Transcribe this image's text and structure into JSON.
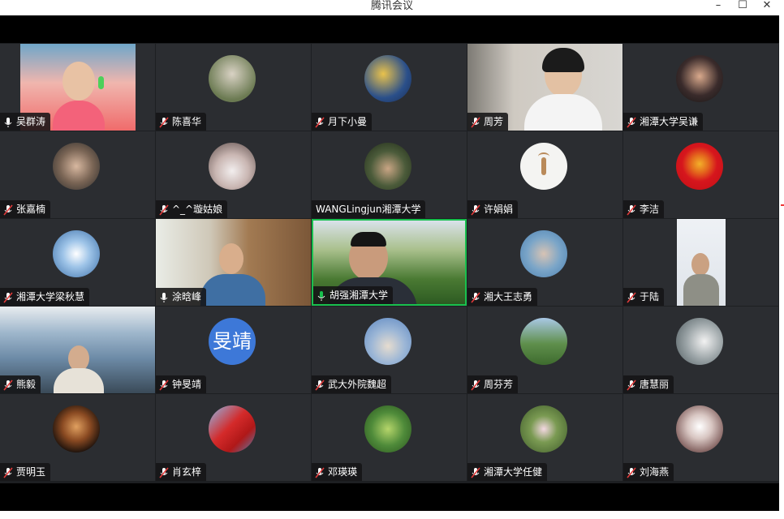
{
  "window": {
    "title": "腾讯会议",
    "minimize": "–",
    "maximize": "☐",
    "close": "✕"
  },
  "participants": [
    {
      "name": "吴群涛",
      "mic": "on"
    },
    {
      "name": "陈喜华",
      "mic": "muted"
    },
    {
      "name": "月下小曼",
      "mic": "muted"
    },
    {
      "name": "周芳",
      "mic": "muted"
    },
    {
      "name": "湘潭大学吴谦",
      "mic": "muted"
    },
    {
      "name": "张嘉楠",
      "mic": "muted"
    },
    {
      "name": "^_^璇姑娘",
      "mic": "muted"
    },
    {
      "name": "WANGLingjun湘潭大学",
      "mic": "none"
    },
    {
      "name": "许娟娟",
      "mic": "muted"
    },
    {
      "name": "李洁",
      "mic": "muted"
    },
    {
      "name": "湘潭大学梁秋慧",
      "mic": "muted"
    },
    {
      "name": "涂晗峰",
      "mic": "on"
    },
    {
      "name": "胡强湘潭大学",
      "mic": "speaking"
    },
    {
      "name": "湘大王志勇",
      "mic": "muted"
    },
    {
      "name": "于陆",
      "mic": "muted"
    },
    {
      "name": "熊毅",
      "mic": "muted"
    },
    {
      "name": "钟旻靖",
      "mic": "muted",
      "avatar_text": "旻靖"
    },
    {
      "name": "武大外院魏超",
      "mic": "muted"
    },
    {
      "name": "周芬芳",
      "mic": "muted"
    },
    {
      "name": "唐慧丽",
      "mic": "muted"
    },
    {
      "name": "贾明玉",
      "mic": "muted"
    },
    {
      "name": "肖玄梓",
      "mic": "muted"
    },
    {
      "name": "邓瑛瑛",
      "mic": "muted"
    },
    {
      "name": "湘潭大学任健",
      "mic": "muted"
    },
    {
      "name": "刘海燕",
      "mic": "muted"
    }
  ],
  "colors": {
    "tile_bg": "#2b2d31",
    "active_border": "#19c04e",
    "muted_mic": "#e23b3b",
    "speaking_mic": "#19c04e"
  }
}
